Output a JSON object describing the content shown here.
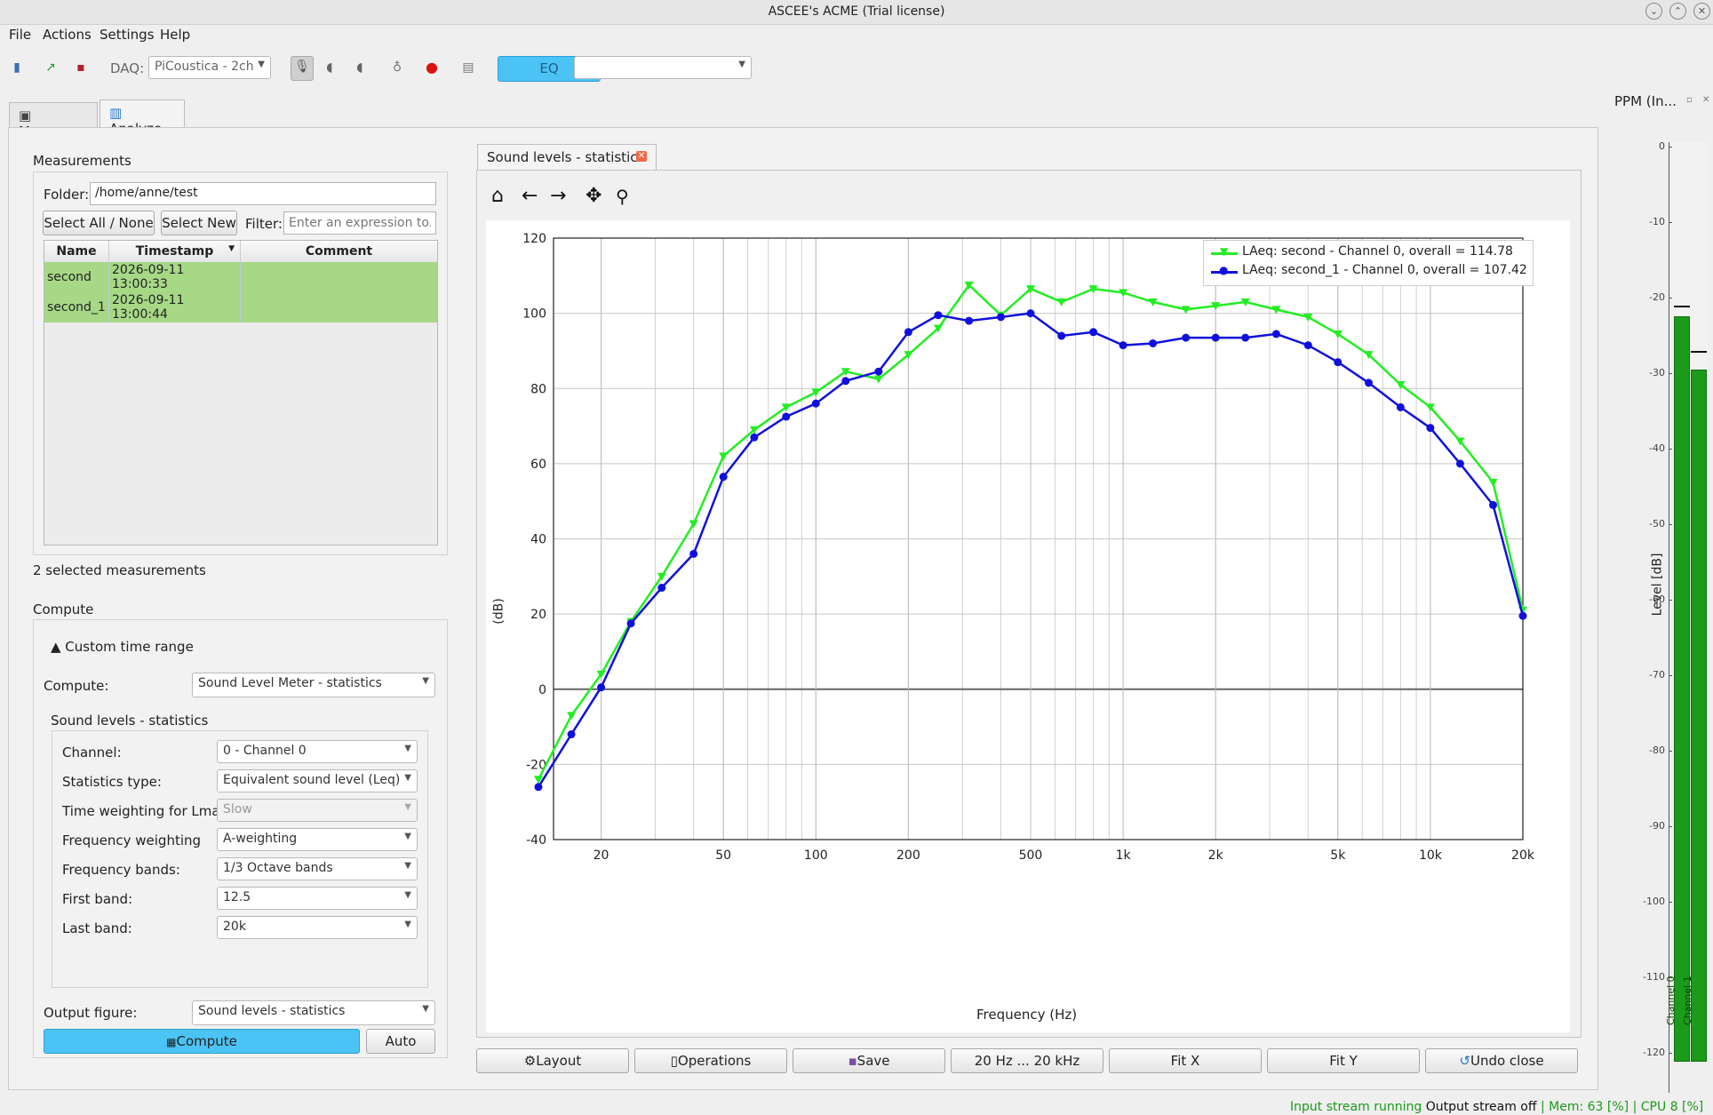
{
  "window": {
    "title": "ASCEE's ACME (Trial license)"
  },
  "menu": [
    "File",
    "Actions",
    "Settings",
    "Help"
  ],
  "toolbar": {
    "daq_label": "DAQ:",
    "daq_value": "PiCoustica - 2ch",
    "eq_label": "EQ",
    "eq_combo_value": ""
  },
  "tabs": {
    "measure": "Measure",
    "analyze": "Analyze"
  },
  "measurements": {
    "section_title": "Measurements",
    "folder_label": "Folder:",
    "folder_value": "/home/anne/test",
    "select_all_label": "Select All / None",
    "select_new_label": "Select New",
    "filter_label": "Filter:",
    "filter_placeholder": "Enter an expression to...",
    "columns": [
      "Name",
      "Timestamp",
      "Comment"
    ],
    "rows": [
      {
        "name": "second",
        "timestamp": "2026-09-11 13:00:33",
        "comment": ""
      },
      {
        "name": "second_1",
        "timestamp": "2026-09-11 13:00:44",
        "comment": ""
      }
    ],
    "selected_count_text": "2 selected measurements"
  },
  "compute": {
    "section_title": "Compute",
    "custom_time_range": "▲ Custom time range",
    "compute_label": "Compute:",
    "compute_value": "Sound Level Meter - statistics",
    "subgroup_title": "Sound levels - statistics",
    "fields": [
      {
        "label": "Channel:",
        "value": "0 - Channel 0",
        "enabled": true
      },
      {
        "label": "Statistics type:",
        "value": "Equivalent sound level (Leq)",
        "enabled": true
      },
      {
        "label": "Time weighting for Lmax:",
        "value": "Slow",
        "enabled": false
      },
      {
        "label": "Frequency weighting",
        "value": "A-weighting",
        "enabled": true
      },
      {
        "label": "Frequency bands:",
        "value": "1/3 Octave bands",
        "enabled": true
      },
      {
        "label": "First band:",
        "value": "12.5",
        "enabled": true
      },
      {
        "label": "Last band:",
        "value": "20k",
        "enabled": true
      }
    ],
    "output_label": "Output figure:",
    "output_value": "Sound levels - statistics",
    "compute_button": "Compute",
    "auto_button": "Auto"
  },
  "figure_tab": {
    "title": "Sound levels - statistics"
  },
  "plot_buttons": [
    "Layout",
    "Operations",
    "Save",
    "20 Hz ... 20 kHz",
    "Fit X",
    "Fit Y",
    "Undo close"
  ],
  "chart_data": {
    "type": "line",
    "xlabel": "Frequency (Hz)",
    "ylabel": "(dB)",
    "x_scale": "log",
    "xlim": [
      14,
      20000
    ],
    "ylim": [
      -40,
      120
    ],
    "x_ticks": [
      20,
      50,
      100,
      200,
      500,
      1000,
      2000,
      5000,
      10000,
      20000
    ],
    "x_tick_labels": [
      "20",
      "50",
      "100",
      "200",
      "500",
      "1k",
      "2k",
      "5k",
      "10k",
      "20k"
    ],
    "y_ticks": [
      -40,
      -20,
      0,
      20,
      40,
      60,
      80,
      100,
      120
    ],
    "grid": true,
    "legend_position": "top-right",
    "x": [
      12.5,
      16,
      20,
      25,
      31.5,
      40,
      50,
      63,
      80,
      100,
      125,
      160,
      200,
      250,
      315,
      400,
      500,
      630,
      800,
      1000,
      1250,
      1600,
      2000,
      2500,
      3150,
      4000,
      5000,
      6300,
      8000,
      10000,
      12500,
      16000,
      20000
    ],
    "series": [
      {
        "name": "LAeq: second - Channel 0, overall = 114.78",
        "color": "#22ee22",
        "marker": "triangle-down",
        "values": [
          -24,
          -7,
          4,
          18,
          30,
          44,
          62,
          69,
          75,
          79,
          84.5,
          82.5,
          89,
          96,
          107.5,
          99.5,
          106.5,
          103,
          106.5,
          105.5,
          103,
          101,
          102,
          103,
          101,
          99,
          94.5,
          89,
          81,
          75,
          66,
          55,
          21
        ]
      },
      {
        "name": "LAeq: second_1 - Channel 0, overall = 107.42",
        "color": "#1010dd",
        "marker": "circle",
        "values": [
          -26,
          -12,
          0.5,
          17.5,
          27,
          36,
          56.5,
          67,
          72.5,
          76,
          82,
          84.5,
          95,
          99.5,
          98,
          99,
          100,
          94,
          95,
          91.5,
          92,
          93.5,
          93.5,
          93.5,
          94.5,
          91.5,
          87,
          81.5,
          75,
          69.5,
          60,
          49,
          19.5
        ]
      }
    ]
  },
  "ppm": {
    "title": "PPM (In...",
    "axis_label": "Level [dB]",
    "scale": [
      "0",
      "-10",
      "-20",
      "-30",
      "-40",
      "-50",
      "-60",
      "-70",
      "-80",
      "-90",
      "-100",
      "-110",
      "-120"
    ],
    "channels": [
      {
        "name": "Channel 0",
        "level": -22.5,
        "peak": -21
      },
      {
        "name": "Channel 1",
        "level": -29.5,
        "peak": -27
      }
    ]
  },
  "status": {
    "input": "Input stream running",
    "output": "Output stream off",
    "mem_label": "Mem:",
    "mem_value": "63 [%]",
    "cpu_label": "CPU",
    "cpu_value": "8 [%]"
  }
}
